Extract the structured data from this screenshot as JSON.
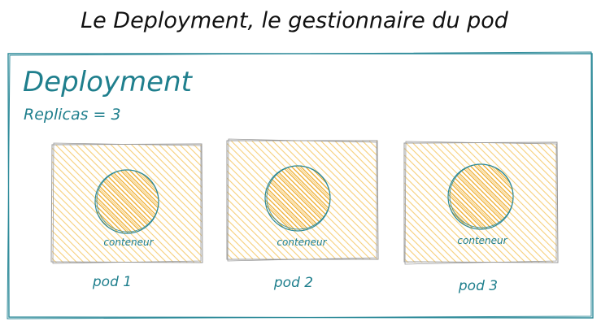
{
  "title": "Le Deployment, le gestionnaire du pod",
  "deployment": {
    "label": "Deployment",
    "replicas_text": "Replicas = 3"
  },
  "pods": [
    {
      "name": "pod 1",
      "container_label": "conteneur"
    },
    {
      "name": "pod 2",
      "container_label": "conteneur"
    },
    {
      "name": "pod 3",
      "container_label": "conteneur"
    }
  ],
  "colors": {
    "stroke_teal": "#2d8a99",
    "text_dark_teal": "#1f7f8d",
    "pod_fill": "#f6c761",
    "pod_stroke": "#9a9a9a",
    "circle_fill": "#f0b53d",
    "title_text": "#111111"
  }
}
